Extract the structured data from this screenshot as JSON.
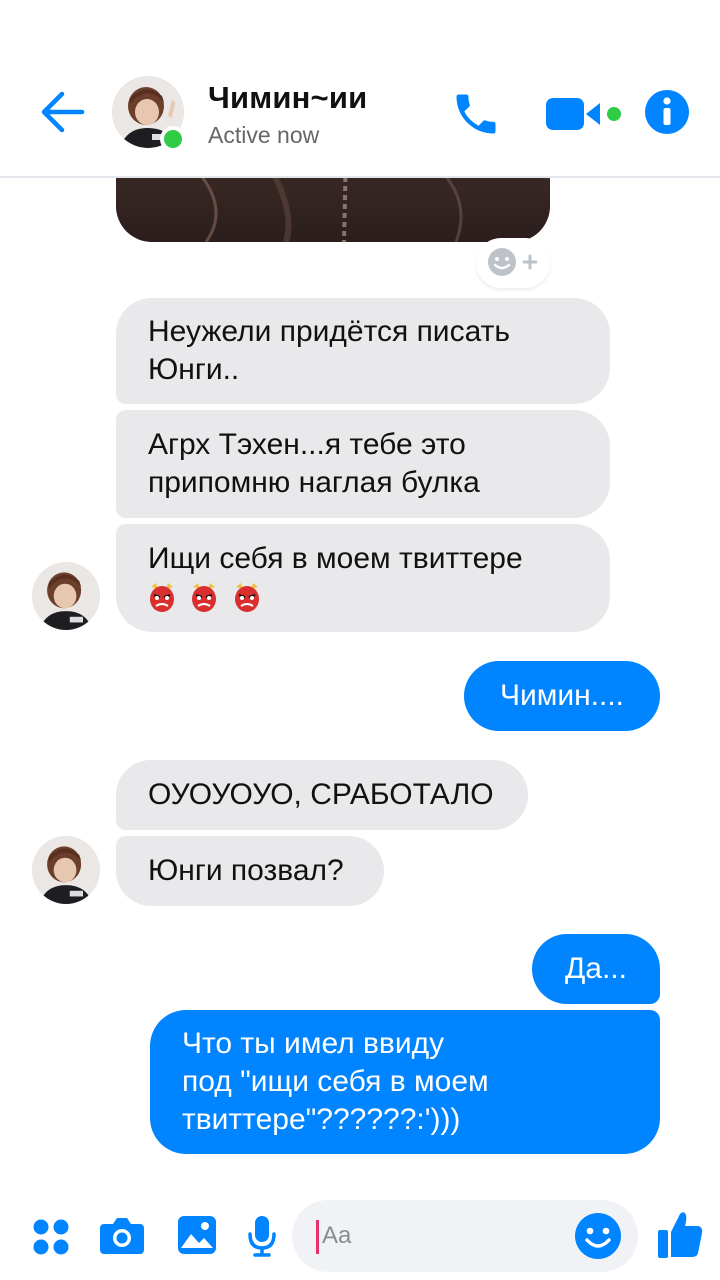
{
  "header": {
    "contact_name": "Чимин~ии",
    "status": "Active now"
  },
  "messages": [
    {
      "dir": "in",
      "text": "Неужели придётся писать\nЮнги.."
    },
    {
      "dir": "in",
      "text": "Агрх Тэхен...я тебе это\nприпомню наглая булка"
    },
    {
      "dir": "in",
      "text": "Ищи себя в моем твиттере",
      "emoji": [
        "japanese-goblin",
        "japanese-goblin",
        "japanese-goblin"
      ]
    },
    {
      "dir": "out",
      "text": "Чимин...."
    },
    {
      "dir": "in",
      "text": "ОУОУОУО, СРАБОТАЛО"
    },
    {
      "dir": "in",
      "text": "Юнги позвал?"
    },
    {
      "dir": "out",
      "text": "Да..."
    },
    {
      "dir": "out",
      "text": "Что ты имел ввиду\nпод \"ищи себя в моем\nтвиттере\"??????:')))"
    }
  ],
  "composer": {
    "placeholder": "Aa"
  },
  "colors": {
    "accent": "#0084ff",
    "incoming_bubble": "#e9e9eb",
    "online": "#31cc46"
  },
  "icons": [
    "back-arrow-icon",
    "phone-icon",
    "video-camera-icon",
    "info-icon",
    "add-reaction-icon",
    "apps-icon",
    "camera-icon",
    "gallery-icon",
    "microphone-icon",
    "emoji-icon",
    "thumbs-up-icon"
  ]
}
